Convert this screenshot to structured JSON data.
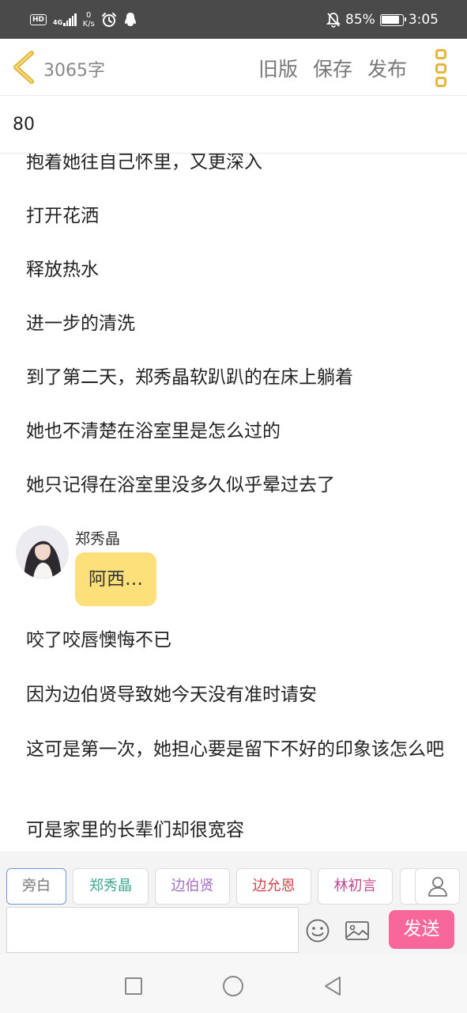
{
  "status_bar": {
    "hd": "HD",
    "network": "4G",
    "speed_value": "0",
    "speed_unit": "K/s",
    "battery_percent": "85%",
    "battery_level": 0.85,
    "time": "3:05"
  },
  "toolbar": {
    "word_count": "3065字",
    "old_version": "旧版",
    "save": "保存",
    "publish": "发布"
  },
  "chapter": {
    "number": "80"
  },
  "content": {
    "paragraphs_before": [
      "抱着她往自己怀里，又更深入",
      "打开花洒",
      "释放热水",
      "进一步的清洗",
      "到了第二天，郑秀晶软趴趴的在床上躺着",
      "她也不清楚在浴室里是怎么过的",
      "她只记得在浴室里没多久似乎晕过去了"
    ],
    "chat": {
      "speaker": "郑秀晶",
      "message": "阿西…"
    },
    "paragraphs_after": [
      "咬了咬唇懊悔不已",
      "因为边伯贤导致她今天没有准时请安",
      "这可是第一次，她担心要是留下不好的印象该怎么吧",
      "可是家里的长辈们却很宽容"
    ]
  },
  "roles": [
    {
      "label": "旁白",
      "color": "#777777"
    },
    {
      "label": "郑秀晶",
      "color": "#3aa890"
    },
    {
      "label": "边伯贤",
      "color": "#a56cc9"
    },
    {
      "label": "边允恩",
      "color": "#d0444a"
    },
    {
      "label": "林初言",
      "color": "#c2488e"
    }
  ],
  "composer": {
    "placeholder": "",
    "send": "发送"
  },
  "icons": {
    "back": "chevron-left-icon",
    "menu": "more-vertical-icon",
    "user": "user-icon",
    "emoji": "smiley-icon",
    "image": "image-icon",
    "alarm": "alarm-icon",
    "qq": "qq-penguin-icon",
    "mute": "bell-off-icon"
  },
  "colors": {
    "accent_yellow": "#e4b63a",
    "bubble": "#fde07a",
    "send": "#f7679a",
    "active_role_border": "#6d9bd6"
  }
}
